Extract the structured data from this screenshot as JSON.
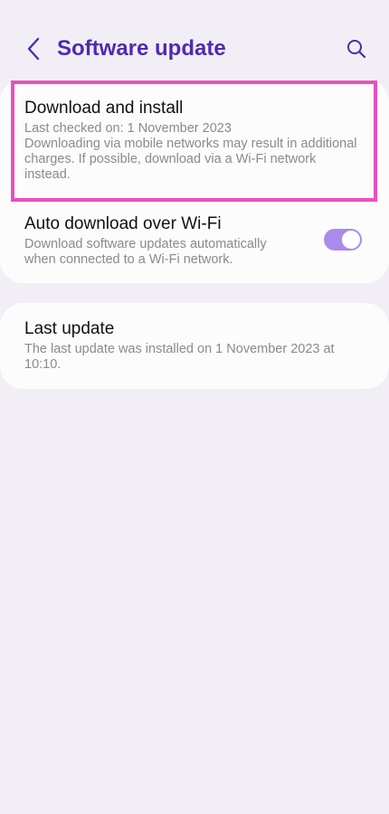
{
  "header": {
    "title": "Software update",
    "back_icon": "chevron-left-icon",
    "search_icon": "search-icon",
    "accent_color": "#4f2bb0"
  },
  "download": {
    "title": "Download and install",
    "last_checked": "Last checked on: 1 November 2023",
    "note_line1": "Downloading via mobile networks may result in additional",
    "note_line2": "charges. If possible, download via a Wi-Fi network",
    "note_line3": "instead."
  },
  "auto_download": {
    "title": "Auto download over Wi-Fi",
    "sub_line1": "Download software updates automatically",
    "sub_line2": "when connected to a Wi-Fi network.",
    "enabled": true,
    "toggle_color": "#a88bec"
  },
  "last_update": {
    "title": "Last update",
    "sub_line1": "The last update was installed on 1 November 2023 at",
    "sub_line2": "10:10."
  },
  "highlight_color": "#ea4fbf"
}
